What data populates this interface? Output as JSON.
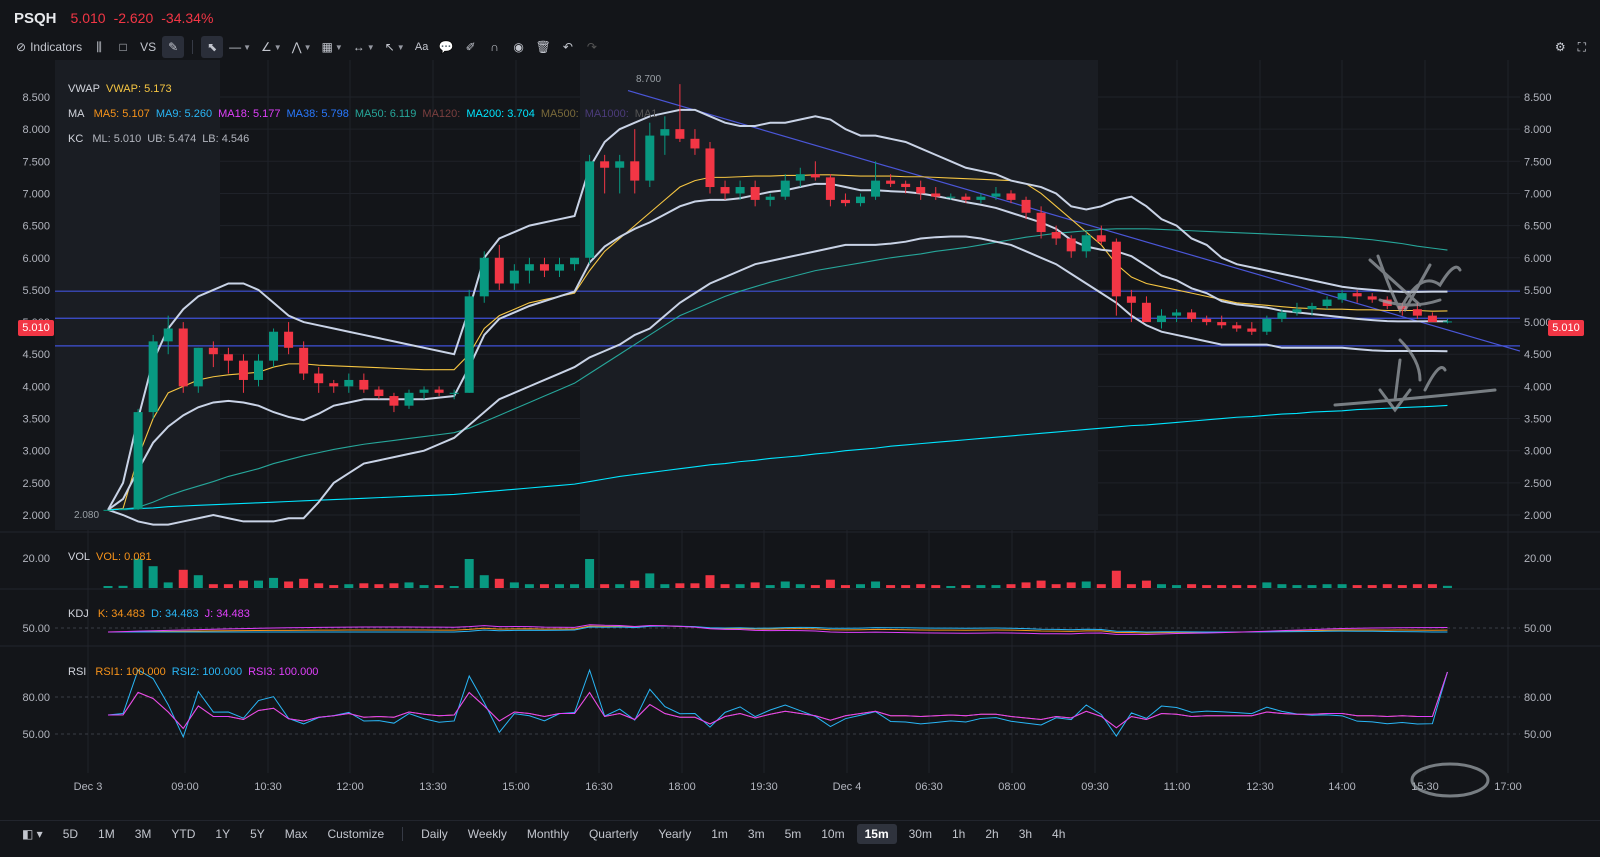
{
  "header": {
    "symbol": "PSQH",
    "price": "5.010",
    "change": "-2.620",
    "change_pct": "-34.34%"
  },
  "toolbar": {
    "indicators_label": "Indicators",
    "vs_label": "VS",
    "text_tool_label": "Aa"
  },
  "legends": {
    "vwap": {
      "title": "VWAP",
      "value": "VWAP: 5.173"
    },
    "ma": {
      "title": "MA",
      "items": [
        {
          "label": "MA5: 5.107",
          "color": "#f7931a"
        },
        {
          "label": "MA9: 5.260",
          "color": "#29b6f6"
        },
        {
          "label": "MA18: 5.177",
          "color": "#e040fb"
        },
        {
          "label": "MA38: 5.798",
          "color": "#2979ff"
        },
        {
          "label": "MA50: 6.119",
          "color": "#26a69a"
        },
        {
          "label": "MA120:",
          "color": "#7b3f3f"
        },
        {
          "label": "MA200: 3.704",
          "color": "#00e5ff"
        },
        {
          "label": "MA500:",
          "color": "#7a6a3a"
        },
        {
          "label": "MA1000:",
          "color": "#4b3b7a"
        },
        {
          "label": "MA1",
          "color": "#555"
        }
      ]
    },
    "kc": {
      "title": "KC",
      "items": [
        "ML: 5.010",
        "UB: 5.474",
        "LB: 4.546"
      ]
    },
    "vol": {
      "title": "VOL",
      "value": "VOL: 0.081"
    },
    "kdj": {
      "title": "KDJ",
      "items": [
        {
          "label": "K: 34.483",
          "color": "#f7931a"
        },
        {
          "label": "D: 34.483",
          "color": "#29b6f6"
        },
        {
          "label": "J: 34.483",
          "color": "#e040fb"
        }
      ]
    },
    "rsi": {
      "title": "RSI",
      "items": [
        {
          "label": "RSI1: 100.000",
          "color": "#f7931a"
        },
        {
          "label": "RSI2: 100.000",
          "color": "#29b6f6"
        },
        {
          "label": "RSI3: 100.000",
          "color": "#e040fb"
        }
      ]
    }
  },
  "price_badge": "5.010",
  "bottombar": {
    "ranges": [
      "5D",
      "1M",
      "3M",
      "YTD",
      "1Y",
      "5Y",
      "Max",
      "Customize"
    ],
    "intervals": [
      "Daily",
      "Weekly",
      "Monthly",
      "Quarterly",
      "Yearly",
      "1m",
      "3m",
      "5m",
      "10m",
      "15m",
      "30m",
      "1h",
      "2h",
      "3h",
      "4h"
    ],
    "active_interval": "15m"
  },
  "colors": {
    "up": "#089981",
    "down": "#f23645",
    "bg": "#131519",
    "grid": "#1f2229"
  },
  "chart_data": {
    "type": "candlestick",
    "ylim": [
      2.0,
      8.5
    ],
    "y_ticks": [
      "8.500",
      "8.000",
      "7.500",
      "7.000",
      "6.500",
      "6.000",
      "5.500",
      "5.000",
      "4.500",
      "4.000",
      "3.500",
      "3.000",
      "2.500",
      "2.000"
    ],
    "x_ticks": [
      "Dec 3",
      "09:00",
      "10:30",
      "12:00",
      "13:30",
      "15:00",
      "16:30",
      "18:00",
      "19:30",
      "Dec 4",
      "06:30",
      "08:00",
      "09:30",
      "11:00",
      "12:30",
      "14:00",
      "15:30",
      "17:00"
    ],
    "annotations": {
      "high": "8.700",
      "low": "2.080"
    },
    "candles": [
      [
        2.08,
        2.08,
        2.08,
        2.08
      ],
      [
        2.08,
        2.1,
        2.08,
        2.09
      ],
      [
        2.09,
        3.65,
        2.08,
        3.6
      ],
      [
        3.6,
        4.8,
        3.5,
        4.7
      ],
      [
        4.7,
        5.1,
        4.5,
        4.9
      ],
      [
        4.9,
        5.0,
        3.9,
        4.0
      ],
      [
        4.0,
        4.6,
        3.9,
        4.6
      ],
      [
        4.6,
        4.7,
        4.3,
        4.5
      ],
      [
        4.5,
        4.6,
        4.2,
        4.4
      ],
      [
        4.4,
        4.5,
        3.9,
        4.1
      ],
      [
        4.1,
        4.5,
        4.0,
        4.4
      ],
      [
        4.4,
        4.9,
        4.3,
        4.85
      ],
      [
        4.85,
        5.0,
        4.5,
        4.6
      ],
      [
        4.6,
        4.7,
        4.1,
        4.2
      ],
      [
        4.2,
        4.3,
        3.9,
        4.05
      ],
      [
        4.05,
        4.1,
        3.9,
        4.0
      ],
      [
        4.0,
        4.2,
        3.9,
        4.1
      ],
      [
        4.1,
        4.2,
        3.9,
        3.95
      ],
      [
        3.95,
        4.0,
        3.8,
        3.85
      ],
      [
        3.85,
        3.9,
        3.6,
        3.7
      ],
      [
        3.7,
        3.95,
        3.65,
        3.9
      ],
      [
        3.9,
        4.0,
        3.8,
        3.95
      ],
      [
        3.95,
        4.0,
        3.85,
        3.9
      ],
      [
        3.9,
        3.95,
        3.8,
        3.9
      ],
      [
        3.9,
        5.5,
        3.9,
        5.4
      ],
      [
        5.4,
        6.1,
        5.3,
        6.0
      ],
      [
        6.0,
        6.2,
        5.5,
        5.6
      ],
      [
        5.6,
        5.9,
        5.5,
        5.8
      ],
      [
        5.8,
        6.0,
        5.6,
        5.9
      ],
      [
        5.9,
        6.0,
        5.7,
        5.8
      ],
      [
        5.8,
        6.0,
        5.7,
        5.9
      ],
      [
        5.9,
        6.0,
        5.8,
        6.0
      ],
      [
        6.0,
        7.6,
        5.9,
        7.5
      ],
      [
        7.5,
        7.6,
        7.0,
        7.4
      ],
      [
        7.4,
        7.6,
        7.0,
        7.5
      ],
      [
        7.5,
        8.0,
        7.0,
        7.2
      ],
      [
        7.2,
        8.1,
        7.1,
        7.9
      ],
      [
        7.9,
        8.2,
        7.6,
        8.0
      ],
      [
        8.0,
        8.7,
        7.8,
        7.85
      ],
      [
        7.85,
        8.0,
        7.6,
        7.7
      ],
      [
        7.7,
        7.8,
        7.0,
        7.1
      ],
      [
        7.1,
        7.2,
        6.9,
        7.0
      ],
      [
        7.0,
        7.2,
        6.9,
        7.1
      ],
      [
        7.1,
        7.2,
        6.8,
        6.9
      ],
      [
        6.9,
        7.0,
        6.8,
        6.95
      ],
      [
        6.95,
        7.3,
        6.9,
        7.2
      ],
      [
        7.2,
        7.4,
        7.1,
        7.3
      ],
      [
        7.3,
        7.5,
        7.2,
        7.25
      ],
      [
        7.25,
        7.3,
        6.8,
        6.9
      ],
      [
        6.9,
        7.0,
        6.8,
        6.85
      ],
      [
        6.85,
        7.0,
        6.8,
        6.95
      ],
      [
        6.95,
        7.5,
        6.9,
        7.2
      ],
      [
        7.2,
        7.3,
        7.1,
        7.15
      ],
      [
        7.15,
        7.2,
        7.0,
        7.1
      ],
      [
        7.1,
        7.2,
        6.9,
        7.0
      ],
      [
        7.0,
        7.1,
        6.9,
        6.95
      ],
      [
        6.95,
        7.0,
        6.9,
        6.95
      ],
      [
        6.95,
        7.0,
        6.85,
        6.9
      ],
      [
        6.9,
        7.0,
        6.85,
        6.95
      ],
      [
        6.95,
        7.1,
        6.9,
        7.0
      ],
      [
        7.0,
        7.05,
        6.85,
        6.9
      ],
      [
        6.9,
        6.95,
        6.6,
        6.7
      ],
      [
        6.7,
        6.8,
        6.3,
        6.4
      ],
      [
        6.4,
        6.5,
        6.2,
        6.3
      ],
      [
        6.3,
        6.35,
        6.0,
        6.1
      ],
      [
        6.1,
        6.4,
        6.0,
        6.35
      ],
      [
        6.35,
        6.5,
        6.2,
        6.25
      ],
      [
        6.25,
        6.3,
        5.1,
        5.4
      ],
      [
        5.4,
        5.5,
        5.0,
        5.3
      ],
      [
        5.3,
        5.4,
        5.0,
        5.0
      ],
      [
        5.0,
        5.2,
        4.9,
        5.1
      ],
      [
        5.1,
        5.2,
        5.0,
        5.15
      ],
      [
        5.15,
        5.2,
        5.0,
        5.05
      ],
      [
        5.05,
        5.1,
        4.95,
        5.0
      ],
      [
        5.0,
        5.1,
        4.9,
        4.95
      ],
      [
        4.95,
        5.0,
        4.85,
        4.9
      ],
      [
        4.9,
        5.0,
        4.8,
        4.85
      ],
      [
        4.85,
        5.1,
        4.8,
        5.05
      ],
      [
        5.05,
        5.2,
        5.0,
        5.15
      ],
      [
        5.15,
        5.3,
        5.1,
        5.2
      ],
      [
        5.2,
        5.3,
        5.1,
        5.25
      ],
      [
        5.25,
        5.4,
        5.2,
        5.35
      ],
      [
        5.35,
        5.5,
        5.3,
        5.45
      ],
      [
        5.45,
        5.5,
        5.3,
        5.4
      ],
      [
        5.4,
        5.45,
        5.3,
        5.35
      ],
      [
        5.35,
        5.4,
        5.2,
        5.25
      ],
      [
        5.25,
        5.3,
        5.1,
        5.2
      ],
      [
        5.2,
        5.3,
        5.05,
        5.1
      ],
      [
        5.1,
        5.15,
        5.0,
        5.0
      ],
      [
        5.0,
        5.05,
        4.98,
        5.01
      ]
    ],
    "ma_series": [
      {
        "name": "VWAP",
        "color": "#f5c542",
        "values": [
          2.08,
          2.1,
          2.9,
          3.5,
          3.9,
          4.0,
          4.1,
          4.15,
          4.18,
          4.2,
          4.22,
          4.3,
          4.35,
          4.35,
          4.33,
          4.32,
          4.31,
          4.3,
          4.29,
          4.28,
          4.27,
          4.26,
          4.26,
          4.26,
          4.5,
          4.9,
          5.1,
          5.2,
          5.3,
          5.35,
          5.4,
          5.45,
          5.8,
          6.1,
          6.3,
          6.5,
          6.7,
          6.9,
          7.1,
          7.2,
          7.25,
          7.25,
          7.26,
          7.27,
          7.27,
          7.28,
          7.28,
          7.29,
          7.29,
          7.28,
          7.27,
          7.27,
          7.27,
          7.26,
          7.26,
          7.25,
          7.24,
          7.23,
          7.22,
          7.21,
          7.2,
          7.15,
          7.0,
          6.8,
          6.6,
          6.4,
          6.2,
          5.9,
          5.7,
          5.6,
          5.55,
          5.5,
          5.45,
          5.4,
          5.35,
          5.3,
          5.28,
          5.26,
          5.24,
          5.22,
          5.21,
          5.2,
          5.2,
          5.19,
          5.19,
          5.18,
          5.18,
          5.18,
          5.17,
          5.173
        ]
      },
      {
        "name": "MA50",
        "color": "#26a69a",
        "values": [
          2.08,
          2.09,
          2.12,
          2.2,
          2.3,
          2.38,
          2.45,
          2.52,
          2.6,
          2.66,
          2.72,
          2.8,
          2.86,
          2.92,
          2.97,
          3.02,
          3.06,
          3.1,
          3.13,
          3.16,
          3.19,
          3.22,
          3.25,
          3.28,
          3.35,
          3.45,
          3.55,
          3.65,
          3.75,
          3.85,
          3.95,
          4.05,
          4.2,
          4.35,
          4.5,
          4.65,
          4.8,
          4.95,
          5.1,
          5.2,
          5.3,
          5.4,
          5.48,
          5.55,
          5.62,
          5.68,
          5.74,
          5.8,
          5.84,
          5.88,
          5.92,
          5.96,
          6.0,
          6.03,
          6.06,
          6.1,
          6.13,
          6.16,
          6.2,
          6.24,
          6.28,
          6.32,
          6.35,
          6.38,
          6.4,
          6.42,
          6.44,
          6.45,
          6.45,
          6.45,
          6.44,
          6.43,
          6.42,
          6.41,
          6.4,
          6.39,
          6.38,
          6.37,
          6.36,
          6.35,
          6.34,
          6.33,
          6.32,
          6.3,
          6.28,
          6.25,
          6.22,
          6.18,
          6.15,
          6.12
        ]
      },
      {
        "name": "MA200",
        "color": "#00e5ff",
        "values": [
          2.08,
          2.09,
          2.1,
          2.11,
          2.13,
          2.14,
          2.15,
          2.16,
          2.17,
          2.18,
          2.19,
          2.2,
          2.21,
          2.22,
          2.23,
          2.24,
          2.25,
          2.26,
          2.27,
          2.28,
          2.29,
          2.3,
          2.31,
          2.32,
          2.34,
          2.36,
          2.38,
          2.4,
          2.42,
          2.44,
          2.46,
          2.48,
          2.52,
          2.56,
          2.6,
          2.63,
          2.66,
          2.69,
          2.72,
          2.75,
          2.78,
          2.8,
          2.83,
          2.85,
          2.88,
          2.9,
          2.92,
          2.95,
          2.97,
          3.0,
          3.02,
          3.04,
          3.07,
          3.09,
          3.11,
          3.13,
          3.15,
          3.17,
          3.19,
          3.21,
          3.23,
          3.25,
          3.27,
          3.29,
          3.31,
          3.33,
          3.35,
          3.37,
          3.39,
          3.4,
          3.42,
          3.44,
          3.46,
          3.48,
          3.5,
          3.52,
          3.53,
          3.55,
          3.57,
          3.58,
          3.6,
          3.61,
          3.62,
          3.64,
          3.65,
          3.66,
          3.67,
          3.68,
          3.69,
          3.704
        ]
      }
    ],
    "kc_upper": [
      2.08,
      2.5,
      3.5,
      4.4,
      4.9,
      5.2,
      5.4,
      5.5,
      5.6,
      5.6,
      5.5,
      5.3,
      5.1,
      5.0,
      4.95,
      4.9,
      4.85,
      4.8,
      4.75,
      4.7,
      4.65,
      4.6,
      4.55,
      4.5,
      5.2,
      6.0,
      6.3,
      6.4,
      6.5,
      6.55,
      6.6,
      6.65,
      7.4,
      7.8,
      8.0,
      8.1,
      8.2,
      8.25,
      8.3,
      8.3,
      8.2,
      8.1,
      8.05,
      8.05,
      8.1,
      8.1,
      8.15,
      8.2,
      8.15,
      8.0,
      7.9,
      7.9,
      7.85,
      7.8,
      7.7,
      7.6,
      7.5,
      7.4,
      7.35,
      7.3,
      7.2,
      7.15,
      7.1,
      7.0,
      6.8,
      6.75,
      6.8,
      6.9,
      6.95,
      6.8,
      6.6,
      6.5,
      6.3,
      6.2,
      6.0,
      5.9,
      5.85,
      5.8,
      5.75,
      5.7,
      5.65,
      5.6,
      5.55,
      5.52,
      5.5,
      5.48,
      5.47,
      5.47,
      5.474,
      5.474
    ],
    "kc_lower": [
      2.08,
      2.0,
      1.9,
      1.85,
      1.85,
      1.9,
      1.95,
      2.0,
      1.95,
      1.9,
      1.9,
      1.9,
      1.95,
      1.95,
      2.2,
      2.5,
      2.65,
      2.8,
      2.85,
      2.9,
      2.95,
      3.0,
      3.1,
      3.2,
      3.4,
      3.6,
      3.8,
      3.9,
      4.0,
      4.1,
      4.2,
      4.3,
      4.45,
      4.55,
      4.65,
      4.8,
      4.9,
      5.1,
      5.3,
      5.45,
      5.6,
      5.7,
      5.8,
      5.9,
      5.95,
      6.0,
      6.05,
      6.1,
      6.15,
      6.2,
      6.2,
      6.2,
      6.22,
      6.25,
      6.3,
      6.32,
      6.33,
      6.33,
      6.3,
      6.25,
      6.2,
      6.1,
      6.0,
      5.9,
      5.75,
      5.6,
      5.45,
      5.3,
      5.1,
      4.95,
      4.85,
      4.8,
      4.75,
      4.7,
      4.65,
      4.65,
      4.65,
      4.65,
      4.6,
      4.6,
      4.6,
      4.6,
      4.6,
      4.58,
      4.56,
      4.55,
      4.55,
      4.55,
      4.55,
      4.546
    ],
    "h_levels": [
      5.48,
      5.06,
      4.63
    ],
    "volume_label": "20.00",
    "kdj_tick": "50.00",
    "rsi_ticks": [
      "80.00",
      "50.00"
    ]
  }
}
